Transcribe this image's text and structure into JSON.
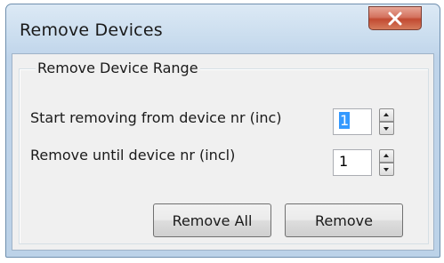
{
  "window": {
    "title": "Remove Devices",
    "close_icon": "close-x-icon"
  },
  "group": {
    "label": "Remove Device Range"
  },
  "fields": {
    "start_label": "Start removing from device nr (inc)",
    "start_value": "1",
    "end_label": "Remove until device nr (incl)",
    "end_value": "1"
  },
  "buttons": {
    "remove_all": "Remove All",
    "remove": "Remove"
  },
  "colors": {
    "close_button": "#c24a32",
    "selection": "#3399ff",
    "frame": "#bcd2e8"
  }
}
